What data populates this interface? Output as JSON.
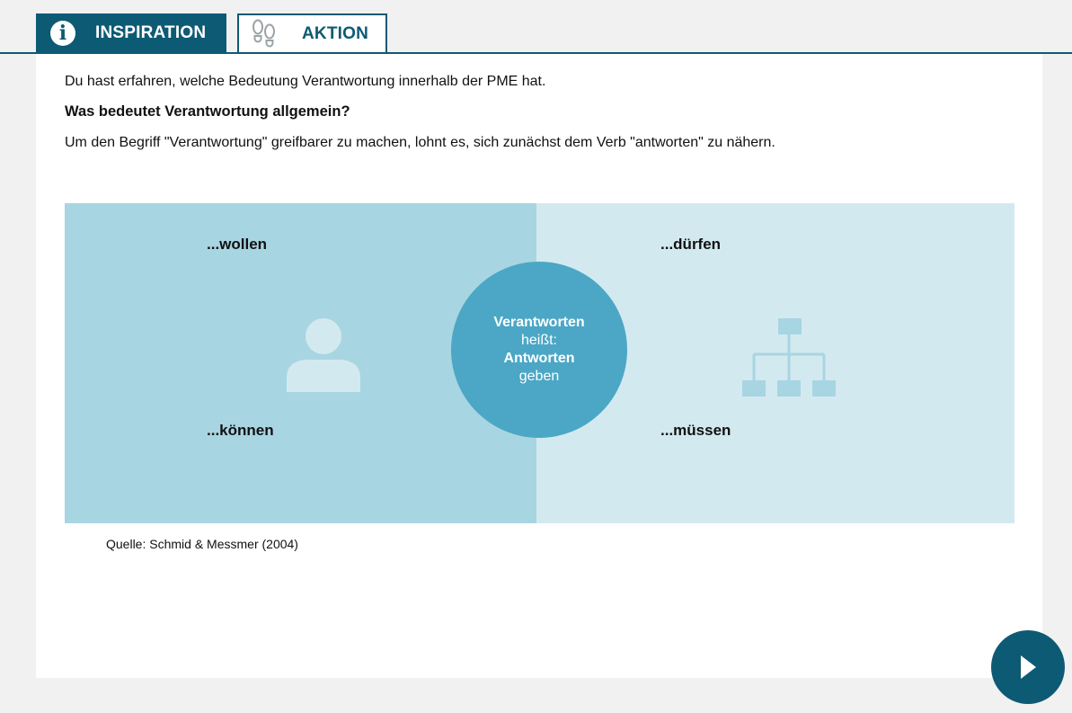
{
  "tabs": [
    {
      "label": "INSPIRATION",
      "icon": "info-icon",
      "active": true
    },
    {
      "label": "AKTION",
      "icon": "footsteps-icon",
      "active": false
    }
  ],
  "content": {
    "intro": "Du hast erfahren, welche Bedeutung Verantwortung innerhalb der PME hat.",
    "heading": "Was bedeutet Verantwortung allgemein?",
    "subtext": "Um den Begriff \"Verantwortung\" greifbarer zu machen, lohnt es, sich zunächst dem Verb \"antworten\" zu nähern."
  },
  "diagram": {
    "top_left": "...wollen",
    "bottom_left": "...können",
    "top_right": "...dürfen",
    "bottom_right": "...müssen",
    "left_icon": "person-icon",
    "right_icon": "org-chart-icon",
    "center": {
      "line1": "Verantworten",
      "line2": "heißt:",
      "line3": "Antworten",
      "line4": "geben"
    }
  },
  "source": "Quelle: Schmid & Messmer (2004)",
  "navigation": {
    "next_icon": "play-arrow-icon"
  },
  "colors": {
    "primary": "#0d5a74",
    "circle": "#4ba7c5",
    "left_panel": "#a8d5e2",
    "right_panel": "#d3e9f0",
    "background": "#f1f1f1"
  }
}
